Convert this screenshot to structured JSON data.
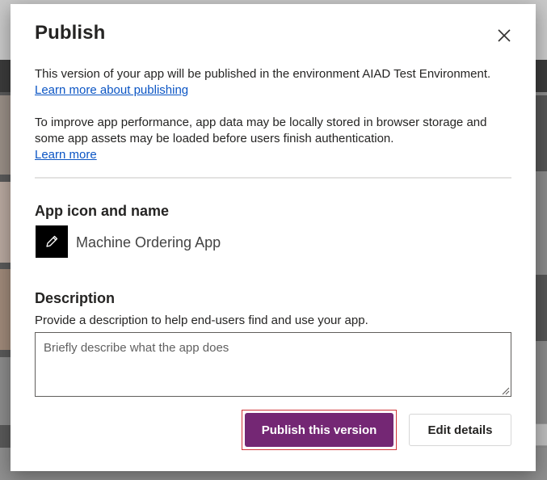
{
  "dialog": {
    "title": "Publish",
    "close_icon": "close-icon",
    "intro_text": "This version of your app will be published in the environment AIAD Test Environment.",
    "learn_more_publishing": "Learn more about publishing",
    "performance_text": "To improve app performance, app data may be locally stored in browser storage and some app assets may be loaded before users finish authentication.",
    "learn_more": "Learn more"
  },
  "app_section": {
    "heading": "App icon and name",
    "icon": "pencil-icon",
    "icon_background": "#000000",
    "app_name": "Machine Ordering App"
  },
  "description_section": {
    "heading": "Description",
    "help_text": "Provide a description to help end-users find and use your app.",
    "value": "",
    "placeholder": "Briefly describe what the app does"
  },
  "actions": {
    "publish_label": "Publish this version",
    "edit_label": "Edit details"
  },
  "colors": {
    "primary_button": "#742774",
    "link": "#0b55c4",
    "focus_outline": "#d13438"
  }
}
